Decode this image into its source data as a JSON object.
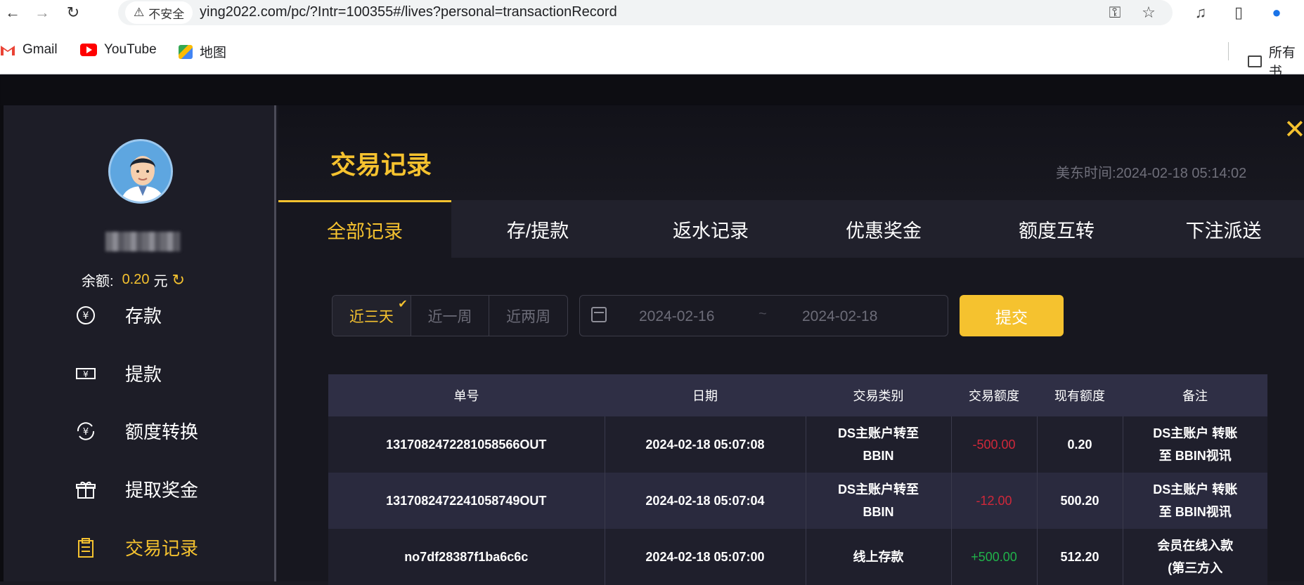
{
  "browser": {
    "security_label": "不安全",
    "url": "ying2022.com/pc/?Intr=100355#/lives?personal=transactionRecord",
    "bookmarks": [
      {
        "label": "Gmail",
        "icon": "gmail-icon"
      },
      {
        "label": "YouTube",
        "icon": "youtube-icon"
      },
      {
        "label": "地图",
        "icon": "maps-icon"
      }
    ],
    "bookmark_folder": "所有书"
  },
  "sidebar": {
    "balance_label": "余额:",
    "balance_amount": "0.20",
    "balance_unit": "元",
    "menu": [
      {
        "label": "存款",
        "icon": "deposit-icon",
        "active": false
      },
      {
        "label": "提款",
        "icon": "withdraw-icon",
        "active": false
      },
      {
        "label": "额度转换",
        "icon": "transfer-icon",
        "active": false
      },
      {
        "label": "提取奖金",
        "icon": "gift-icon",
        "active": false
      },
      {
        "label": "交易记录",
        "icon": "clipboard-icon",
        "active": true
      }
    ]
  },
  "header": {
    "title": "交易记录",
    "us_time_label": "美东时间:",
    "us_time": "2024-02-18 05:14:02"
  },
  "tabs": [
    "全部记录",
    "存/提款",
    "返水记录",
    "优惠奖金",
    "额度互转",
    "下注派送"
  ],
  "filter": {
    "ranges": [
      "近三天",
      "近一周",
      "近两周"
    ],
    "active_range": "近三天",
    "start_date": "2024-02-16",
    "separator": "~",
    "end_date": "2024-02-18",
    "submit_label": "提交"
  },
  "table": {
    "columns": [
      "单号",
      "日期",
      "交易类别",
      "交易额度",
      "现有额度",
      "备注"
    ],
    "rows": [
      {
        "order": "1317082472281058566OUT",
        "date": "2024-02-18 05:07:08",
        "type_line1": "DS主账户转至",
        "type_line2": "BBIN",
        "amount": "-500.00",
        "balance": "0.20",
        "note_line1": "DS主账户 转账",
        "note_line2": "至 BBIN视讯"
      },
      {
        "order": "1317082472241058749OUT",
        "date": "2024-02-18 05:07:04",
        "type_line1": "DS主账户转至",
        "type_line2": "BBIN",
        "amount": "-12.00",
        "balance": "500.20",
        "note_line1": "DS主账户 转账",
        "note_line2": "至 BBIN视讯"
      },
      {
        "order": "no7df28387f1ba6c6c",
        "date": "2024-02-18 05:07:00",
        "type_line1": "线上存款",
        "type_line2": "",
        "amount": "+500.00",
        "balance": "512.20",
        "note_line1": "会员在线入款",
        "note_line2": "(第三方入"
      }
    ]
  },
  "colors": {
    "accent": "#f5c22f",
    "negative": "#d0283a",
    "positive": "#20b34a",
    "header_row": "#2f2f45"
  }
}
